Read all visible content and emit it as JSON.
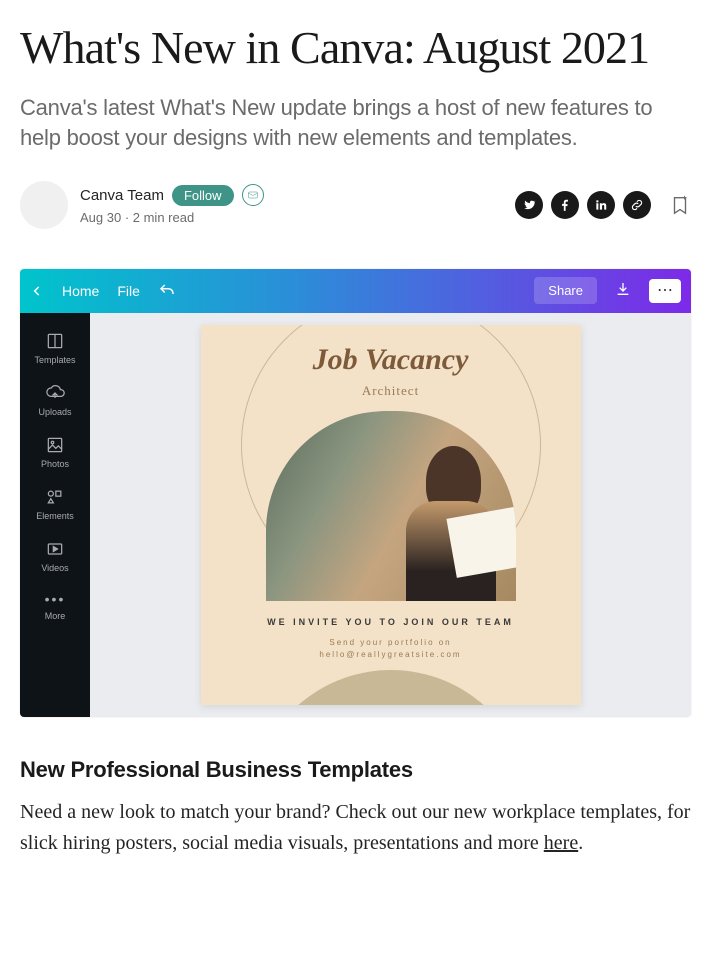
{
  "article": {
    "title": "What's New in Canva: August 2021",
    "subtitle": "Canva's latest What's New update brings a host of new features to help boost your designs with new elements and templates.",
    "author": "Canva Team",
    "follow": "Follow",
    "date": "Aug 30",
    "read_time": "2 min read"
  },
  "editor": {
    "home": "Home",
    "file": "File",
    "share": "Share",
    "sidebar": {
      "templates": "Templates",
      "uploads": "Uploads",
      "photos": "Photos",
      "elements": "Elements",
      "videos": "Videos",
      "more": "More"
    }
  },
  "poster": {
    "title": "Job Vacancy",
    "subtitle": "Architect",
    "invite": "WE INVITE YOU TO JOIN OUR TEAM",
    "line1": "Send your portfolio on",
    "line2": "hello@reallygreatsite.com"
  },
  "section": {
    "heading": "New Professional Business Templates",
    "body_prefix": "Need a new look to match your brand? Check out our new workplace templates, for slick hiring posters, social media visuals, presentations and more ",
    "link": "here",
    "body_suffix": "."
  }
}
